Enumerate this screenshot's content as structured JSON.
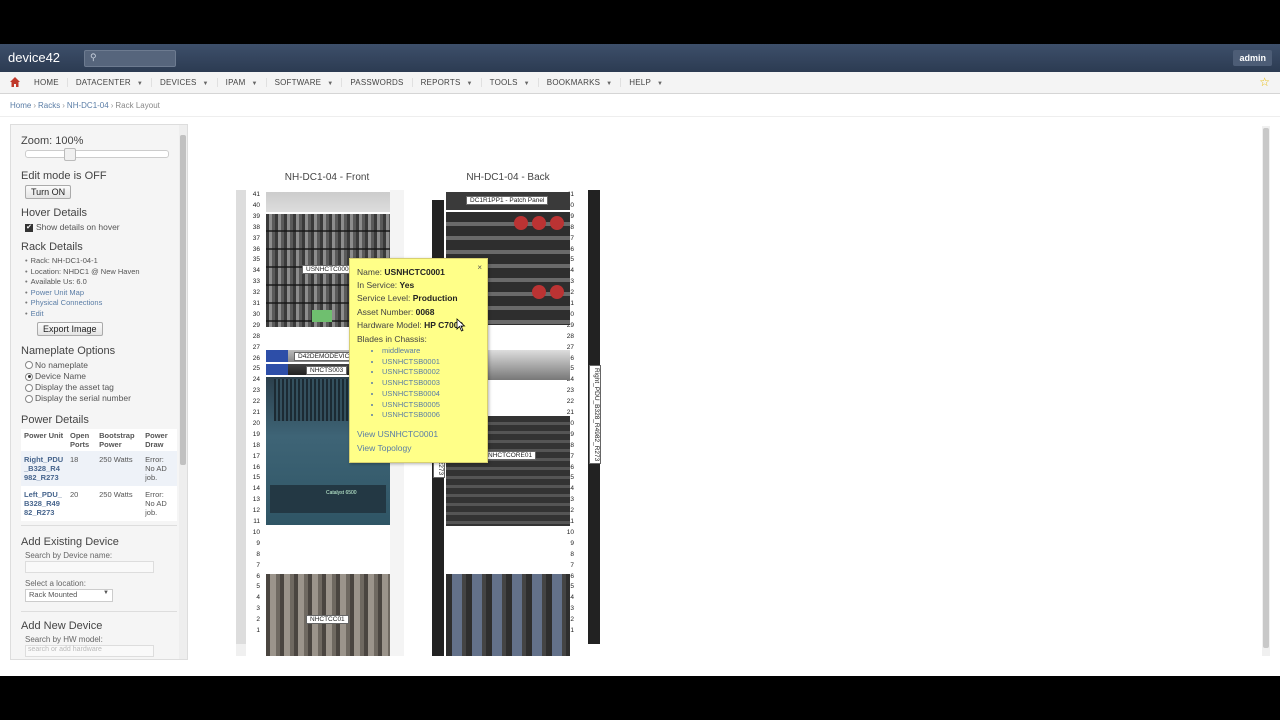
{
  "app": {
    "logo": "device42",
    "user": "admin"
  },
  "nav": {
    "items": [
      {
        "label": "HOME",
        "caret": false
      },
      {
        "label": "DATACENTER",
        "caret": true
      },
      {
        "label": "DEVICES",
        "caret": true
      },
      {
        "label": "IPAM",
        "caret": true
      },
      {
        "label": "SOFTWARE",
        "caret": true
      },
      {
        "label": "PASSWORDS",
        "caret": false
      },
      {
        "label": "REPORTS",
        "caret": true
      },
      {
        "label": "TOOLS",
        "caret": true
      },
      {
        "label": "BOOKMARKS",
        "caret": true
      },
      {
        "label": "HELP",
        "caret": true
      }
    ]
  },
  "breadcrumb": {
    "home": "Home",
    "racks": "Racks",
    "rack": "NH-DC1-04",
    "current": "Rack Layout"
  },
  "sidebar": {
    "zoom": "Zoom: 100%",
    "edit_mode": "Edit mode is OFF",
    "turn_on": "Turn ON",
    "hover_title": "Hover Details",
    "hover_check": "Show details on hover",
    "rack_details_title": "Rack Details",
    "rack_name": "Rack: NH-DC1-04-1",
    "location": "Location: NHDC1 @ New Haven",
    "available": "Available Us: 6.0",
    "power_map": "Power Unit Map",
    "physical": "Physical Connections",
    "edit": "Edit",
    "export": "Export Image",
    "nameplate_title": "Nameplate Options",
    "nameplate_opts": [
      "No nameplate",
      "Device Name",
      "Display the asset tag",
      "Display the serial number"
    ],
    "nameplate_selected": 1,
    "power_title": "Power Details",
    "power_headers": [
      "Power Unit",
      "Open Ports",
      "Bootstrap Power",
      "Power Draw"
    ],
    "power_rows": [
      {
        "unit": "Right_PDU_B328_R4982_R273",
        "ports": "18",
        "boot": "250 Watts",
        "draw": "Error: No AD job."
      },
      {
        "unit": "Left_PDU_B328_R4982_R273",
        "ports": "20",
        "boot": "250 Watts",
        "draw": "Error: No AD job."
      }
    ],
    "add_existing_title": "Add Existing Device",
    "search_device_label": "Search by Device name:",
    "select_location_label": "Select a location:",
    "location_value": "Rack Mounted",
    "add_new_title": "Add New Device",
    "search_hw_label": "Search by HW model:",
    "search_hw_placeholder": "search or add hardware"
  },
  "racks": {
    "front_title": "NH-DC1-04 - Front",
    "back_title": "NH-DC1-04 - Back",
    "units": [
      41,
      40,
      39,
      38,
      37,
      36,
      35,
      34,
      33,
      32,
      31,
      30,
      29,
      28,
      27,
      26,
      25,
      24,
      23,
      22,
      21,
      20,
      19,
      18,
      17,
      16,
      15,
      14,
      13,
      12,
      11,
      10,
      9,
      8,
      7,
      6,
      5,
      4,
      3,
      2,
      1
    ],
    "front_devices": [
      "USNHCTC0001",
      "D42DEMODEVICE",
      "NHCTS003",
      "NHCTCC01"
    ],
    "back_devices": [
      "DC1R1PP1 - Patch Panel",
      "NHCTCORE01"
    ],
    "pdu_right": "Right_PDU_B328_R4982_R273",
    "pdu_left": "B328_R4982_R273",
    "catalyst_text": "Catalyst 6500"
  },
  "tooltip": {
    "name_label": "Name:",
    "name": "USNHCTC0001",
    "service_label": "In Service:",
    "service": "Yes",
    "level_label": "Service Level:",
    "level": "Production",
    "asset_label": "Asset Number:",
    "asset": "0068",
    "hw_label": "Hardware Model:",
    "hw": "HP C7000",
    "blades_label": "Blades in Chassis:",
    "blades": [
      "middleware",
      "USNHCTSB0001",
      "USNHCTSB0002",
      "USNHCTSB0003",
      "USNHCTSB0004",
      "USNHCTSB0005",
      "USNHCTSB0006"
    ],
    "view_device": "View USNHCTC0001",
    "view_topology": "View Topology",
    "close": "×"
  },
  "colors": {
    "topbar": "#33445e",
    "tooltip": "#ffff88",
    "link": "#5a7da6"
  }
}
